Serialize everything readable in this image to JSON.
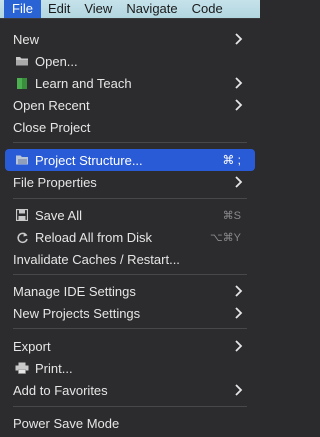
{
  "menubar": {
    "items": [
      "File",
      "Edit",
      "View",
      "Navigate",
      "Code"
    ]
  },
  "menu": {
    "new": "New",
    "open": "Open...",
    "learn": "Learn and Teach",
    "open_recent": "Open Recent",
    "close_project": "Close Project",
    "project_structure": "Project Structure...",
    "project_structure_shortcut": "⌘ ;",
    "file_properties": "File Properties",
    "save_all": "Save All",
    "save_all_shortcut": "⌘S",
    "reload": "Reload All from Disk",
    "reload_shortcut": "⌥⌘Y",
    "invalidate": "Invalidate Caches / Restart...",
    "manage_ide": "Manage IDE Settings",
    "new_projects_settings": "New Projects Settings",
    "export": "Export",
    "print": "Print...",
    "favorites": "Add to Favorites",
    "power_save": "Power Save Mode"
  },
  "colors": {
    "menubar_bg": "#b8d9e3",
    "active_menu": "#2a63d4",
    "menu_bg": "#2c2c2e",
    "highlight": "#2a5bd7",
    "text": "#e6e6e6",
    "shortcut": "#8a8a8e",
    "separator": "#48484b"
  },
  "icons": {
    "open": "folder-icon",
    "learn": "book-icon",
    "project_structure": "project-structure-icon",
    "save_all": "save-icon",
    "reload": "reload-icon",
    "print": "printer-icon",
    "submenu": "chevron-right-icon"
  }
}
